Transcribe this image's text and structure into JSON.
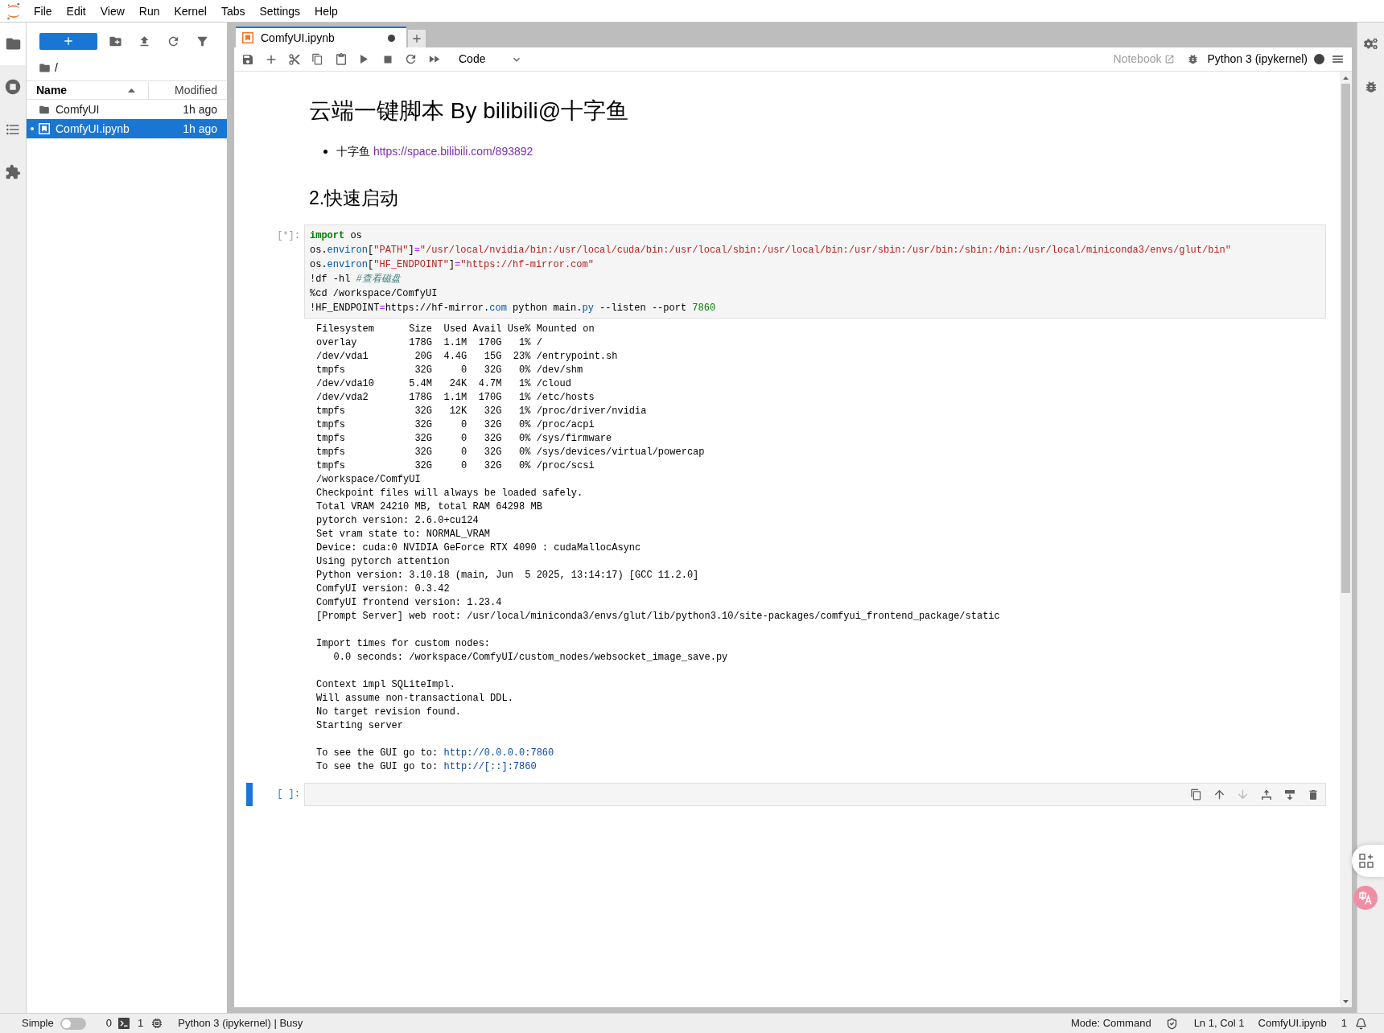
{
  "menu_bar": {
    "items": [
      "File",
      "Edit",
      "View",
      "Run",
      "Kernel",
      "Tabs",
      "Settings",
      "Help"
    ]
  },
  "left_sidebar": {
    "tabs": [
      {
        "kind": "files",
        "selected": true
      },
      {
        "kind": "running",
        "selected": false
      },
      {
        "kind": "toc",
        "selected": false
      },
      {
        "kind": "extensions",
        "selected": false
      }
    ]
  },
  "file_browser": {
    "path": "/",
    "columns": [
      {
        "label": "Name",
        "sorted": true
      },
      {
        "label": "Modified",
        "sorted": false
      }
    ],
    "items": [
      {
        "kind": "folder",
        "name": "ComfyUI",
        "modified": "1h ago",
        "selected": false,
        "running": false
      },
      {
        "kind": "notebook",
        "name": "ComfyUI.ipynb",
        "modified": "1h ago",
        "selected": true,
        "running": true
      }
    ]
  },
  "tabs": [
    {
      "label": "ComfyUI.ipynb",
      "selected": true,
      "dirty": true
    }
  ],
  "toolbar": {
    "cell_type": "Code",
    "open_in": "Notebook",
    "kernel": "Python 3 (ipykernel)",
    "kernel_busy": true
  },
  "notebook": {
    "cells": [
      {
        "kind": "markdown",
        "selected": false,
        "blocks": [
          {
            "kind": "h1",
            "text": "云端一键脚本 By bilibili@十字鱼"
          },
          {
            "kind": "bullet",
            "text": "十字鱼",
            "link": "https://space.bilibili.com/893892"
          }
        ]
      },
      {
        "kind": "markdown",
        "selected": false,
        "blocks": [
          {
            "kind": "h2",
            "text": "2.快速启动"
          }
        ]
      },
      {
        "kind": "code",
        "selected": false,
        "prompt": "[*]:",
        "code": [
          [
            {
              "kind": "keyword",
              "text": "import"
            },
            {
              "kind": "plain",
              "text": " os"
            }
          ],
          [
            {
              "kind": "plain",
              "text": "os."
            },
            {
              "kind": "attr",
              "text": "environ"
            },
            {
              "kind": "plain",
              "text": "["
            },
            {
              "kind": "string",
              "text": "\"PATH\""
            },
            {
              "kind": "plain",
              "text": "]"
            },
            {
              "kind": "operator",
              "text": "="
            },
            {
              "kind": "string",
              "text": "\"/usr/local/nvidia/bin:/usr/local/cuda/bin:/usr/local/sbin:/usr/local/bin:/usr/sbin:/usr/bin:/sbin:/bin:/usr/local/miniconda3/envs/glut/bin\""
            }
          ],
          [
            {
              "kind": "plain",
              "text": "os."
            },
            {
              "kind": "attr",
              "text": "environ"
            },
            {
              "kind": "plain",
              "text": "["
            },
            {
              "kind": "string",
              "text": "\"HF_ENDPOINT\""
            },
            {
              "kind": "plain",
              "text": "]"
            },
            {
              "kind": "operator",
              "text": "="
            },
            {
              "kind": "string",
              "text": "\"https://hf-mirror.com\""
            }
          ],
          [
            {
              "kind": "plain",
              "text": "!df -hl "
            },
            {
              "kind": "comment",
              "text": "#查看磁盘"
            }
          ],
          [
            {
              "kind": "plain",
              "text": "%cd /workspace/ComfyUI"
            }
          ],
          [
            {
              "kind": "plain",
              "text": "!HF_ENDPOINT"
            },
            {
              "kind": "operator",
              "text": "="
            },
            {
              "kind": "plain",
              "text": "https://hf-mirror."
            },
            {
              "kind": "attr",
              "text": "com"
            },
            {
              "kind": "plain",
              "text": " python main."
            },
            {
              "kind": "attr",
              "text": "py"
            },
            {
              "kind": "plain",
              "text": " --listen --port "
            },
            {
              "kind": "number",
              "text": "7860"
            }
          ]
        ],
        "output_blocks": [
          [
            "Filesystem      Size  Used Avail Use% Mounted on",
            "overlay         178G  1.1M  170G   1% /",
            "/dev/vda1        20G  4.4G   15G  23% /entrypoint.sh",
            "tmpfs            32G     0   32G   0% /dev/shm",
            "/dev/vda10      5.4M   24K  4.7M   1% /cloud",
            "/dev/vda2       178G  1.1M  170G   1% /etc/hosts",
            "tmpfs            32G   12K   32G   1% /proc/driver/nvidia",
            "tmpfs            32G     0   32G   0% /proc/acpi",
            "tmpfs            32G     0   32G   0% /sys/firmware",
            "tmpfs            32G     0   32G   0% /sys/devices/virtual/powercap",
            "tmpfs            32G     0   32G   0% /proc/scsi",
            "/workspace/ComfyUI",
            "Checkpoint files will always be loaded safely.",
            "Total VRAM 24210 MB, total RAM 64298 MB",
            "pytorch version: 2.6.0+cu124",
            "Set vram state to: NORMAL_VRAM",
            "Device: cuda:0 NVIDIA GeForce RTX 4090 : cudaMallocAsync",
            "Using pytorch attention",
            "Python version: 3.10.18 (main, Jun  5 2025, 13:14:17) [GCC 11.2.0]",
            "ComfyUI version: 0.3.42",
            "ComfyUI frontend version: 1.23.4",
            "[Prompt Server] web root: /usr/local/miniconda3/envs/glut/lib/python3.10/site-packages/comfyui_frontend_package/static"
          ],
          [
            "Import times for custom nodes:",
            "   0.0 seconds: /workspace/ComfyUI/custom_nodes/websocket_image_save.py"
          ],
          [
            "Context impl SQLiteImpl.",
            "Will assume non-transactional DDL.",
            "No target revision found.",
            "Starting server"
          ],
          [
            {
              "text": "To see the GUI go to:",
              "link": "http://0.0.0.0:7860"
            },
            {
              "text": "To see the GUI go to:",
              "link": "http://[::]:7860"
            }
          ]
        ]
      },
      {
        "kind": "code",
        "selected": true,
        "prompt": "[ ]:",
        "toolbar": [
          {
            "kind": "duplicate",
            "disabled": false
          },
          {
            "kind": "move_up",
            "disabled": false
          },
          {
            "kind": "move_down",
            "disabled": true
          },
          {
            "kind": "insert_above",
            "disabled": false
          },
          {
            "kind": "insert_below",
            "disabled": false
          },
          {
            "kind": "delete",
            "disabled": false
          }
        ]
      }
    ]
  },
  "right_sidebar": {
    "tabs": [
      {
        "kind": "properties",
        "selected": false
      },
      {
        "kind": "debugger",
        "selected": false
      }
    ]
  },
  "status_bar": {
    "simple_label": "Simple",
    "simple_mode": false,
    "terminals": "0",
    "kernels": "1",
    "kernel_status": "Python 3 (ipykernel) | Busy",
    "mode": "Mode: Command",
    "cursor": "Ln 1, Col 1",
    "file": "ComfyUI.ipynb",
    "notifications": "1"
  }
}
